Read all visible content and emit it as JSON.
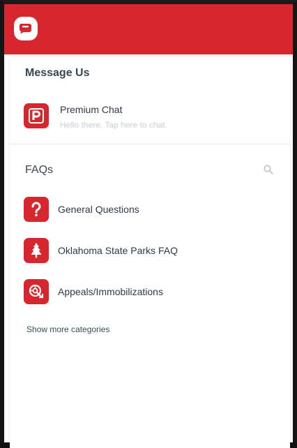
{
  "message_us": {
    "title": "Message Us",
    "premium_chat": {
      "label": "Premium Chat",
      "subtitle": "Hello there. Tap here to chat."
    }
  },
  "faqs": {
    "title": "FAQs",
    "categories": [
      {
        "label": "General Questions",
        "icon": "question-icon"
      },
      {
        "label": "Oklahoma State Parks FAQ",
        "icon": "tree-icon"
      },
      {
        "label": "Appeals/Immobilizations",
        "icon": "wheel-boot-icon"
      }
    ],
    "show_more": "Show more categories"
  },
  "colors": {
    "brand": "#d8262f",
    "text": "#2e3a46",
    "muted": "#c3cad3"
  }
}
